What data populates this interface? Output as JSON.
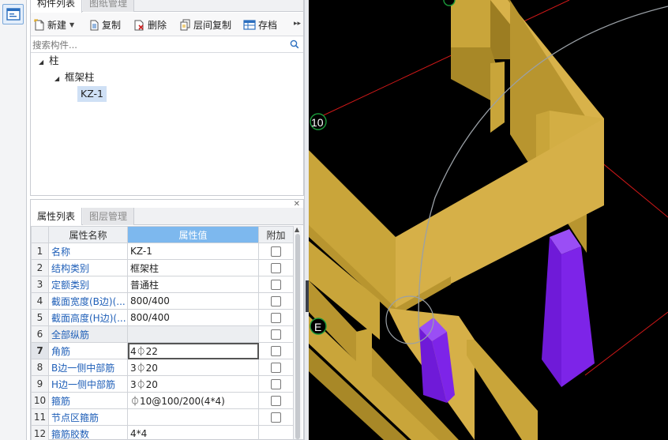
{
  "component_panel": {
    "tabs": [
      "构件列表",
      "图纸管理"
    ],
    "toolbar": {
      "new": "新建",
      "copy": "复制",
      "delete": "删除",
      "floor_copy": "层间复制",
      "save": "存档"
    },
    "search_placeholder": "搜索构件...",
    "tree": {
      "root": "柱",
      "child": "框架柱",
      "leaf": "KZ-1"
    }
  },
  "property_panel": {
    "tabs": [
      "属性列表",
      "图层管理"
    ],
    "headers": [
      "属性名称",
      "属性值",
      "附加"
    ],
    "rows": [
      {
        "n": "1",
        "name": "名称",
        "value": "KZ-1"
      },
      {
        "n": "2",
        "name": "结构类别",
        "value": "框架柱"
      },
      {
        "n": "3",
        "name": "定额类别",
        "value": "普通柱"
      },
      {
        "n": "4",
        "name": "截面宽度(B边)(...",
        "value": "800/400"
      },
      {
        "n": "5",
        "name": "截面高度(H边)(...",
        "value": "800/400"
      },
      {
        "n": "6",
        "name": "全部纵筋",
        "value": ""
      },
      {
        "n": "7",
        "name": "角筋",
        "value": "4⏀22"
      },
      {
        "n": "8",
        "name": "B边一侧中部筋",
        "value": "3⏀20"
      },
      {
        "n": "9",
        "name": "H边一侧中部筋",
        "value": "3⏀20"
      },
      {
        "n": "10",
        "name": "箍筋",
        "value": "⏀10@100/200(4*4)"
      },
      {
        "n": "11",
        "name": "节点区箍筋",
        "value": ""
      },
      {
        "n": "12",
        "name": "箍筋胶数",
        "value": "4*4"
      }
    ]
  },
  "viewport": {
    "axis_labels": {
      "ten": "10",
      "e": "E"
    },
    "colors": {
      "background": "#000000",
      "wall": "#c9a53a",
      "column": "#7a1fd6",
      "grid": "#d01818"
    }
  }
}
